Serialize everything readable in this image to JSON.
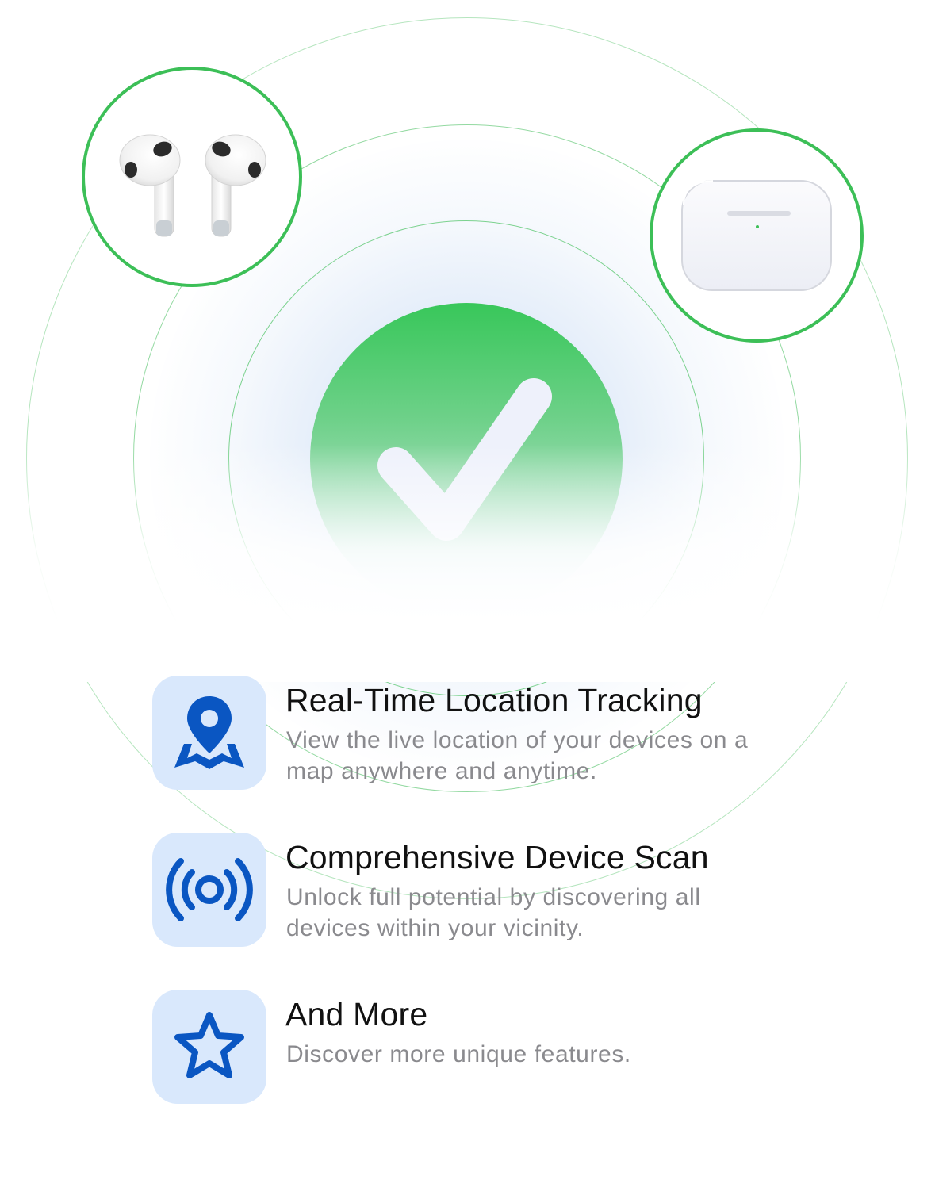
{
  "colors": {
    "accent_green": "#3cbf57",
    "icon_blue": "#0a56c2",
    "icon_tile_bg": "#d9e8fc",
    "title_text": "#111111",
    "description_text": "#8a8a8e"
  },
  "hero": {
    "center_icon": "checkmark-icon",
    "devices": [
      {
        "name": "airpods-earbuds-image"
      },
      {
        "name": "airpods-case-image"
      }
    ]
  },
  "features": [
    {
      "icon": "location-pin-map-icon",
      "title": "Real-Time Location Tracking",
      "description": "View the live location of your devices on a map anywhere and anytime."
    },
    {
      "icon": "broadcast-scan-icon",
      "title": "Comprehensive Device Scan",
      "description": "Unlock full potential by discovering all devices within your vicinity."
    },
    {
      "icon": "star-icon",
      "title": "And More",
      "description": "Discover more unique features."
    }
  ]
}
